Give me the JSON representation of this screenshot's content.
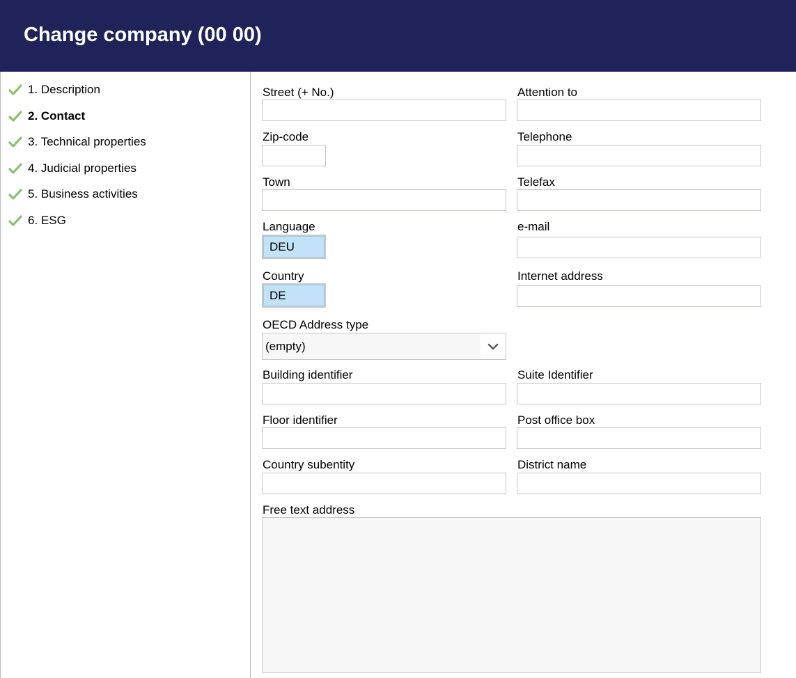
{
  "header": {
    "title": "Change company (00 00)"
  },
  "steps": [
    {
      "label": "1. Description",
      "active": false
    },
    {
      "label": "2. Contact",
      "active": true
    },
    {
      "label": "3. Technical properties",
      "active": false
    },
    {
      "label": "4. Judicial properties",
      "active": false
    },
    {
      "label": "5. Business activities",
      "active": false
    },
    {
      "label": "6. ESG",
      "active": false
    }
  ],
  "colors": {
    "header_bg": "#1f2359",
    "check": "#8cc16b",
    "lookup_bg": "#c2e2f8"
  },
  "form": {
    "street": {
      "label": "Street (+ No.)",
      "value": ""
    },
    "attention": {
      "label": "Attention to",
      "value": ""
    },
    "zip": {
      "label": "Zip-code",
      "value": ""
    },
    "telephone": {
      "label": "Telephone",
      "value": ""
    },
    "town": {
      "label": "Town",
      "value": ""
    },
    "telefax": {
      "label": "Telefax",
      "value": ""
    },
    "language": {
      "label": "Language",
      "value": "DEU"
    },
    "email": {
      "label": "e-mail",
      "value": ""
    },
    "country": {
      "label": "Country",
      "value": "DE"
    },
    "internet": {
      "label": "Internet address",
      "value": ""
    },
    "oecd": {
      "label": "OECD Address type",
      "value": "(empty)"
    },
    "building": {
      "label": "Building identifier",
      "value": ""
    },
    "suite": {
      "label": "Suite Identifier",
      "value": ""
    },
    "floor": {
      "label": "Floor identifier",
      "value": ""
    },
    "pobox": {
      "label": "Post office box",
      "value": ""
    },
    "subentity": {
      "label": "Country subentity",
      "value": ""
    },
    "district": {
      "label": "District name",
      "value": ""
    },
    "freetext": {
      "label": "Free text address",
      "value": ""
    }
  }
}
